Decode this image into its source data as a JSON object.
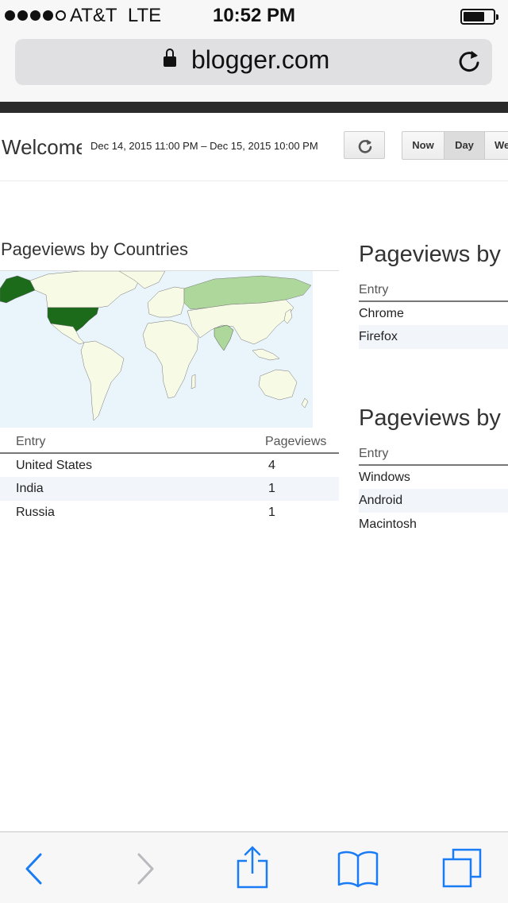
{
  "status_bar": {
    "carrier": "AT&T",
    "network": "LTE",
    "time": "10:52 PM",
    "signal_bars": 4,
    "signal_max": 5
  },
  "address_bar": {
    "url": "blogger.com"
  },
  "toolbar": {
    "welcome": "Welcome",
    "date_range": "Dec 14, 2015 11:00 PM – Dec 15, 2015 10:00 PM",
    "ranges": [
      "Now",
      "Day",
      "Week"
    ],
    "selected_range": "Day"
  },
  "countries": {
    "title": "Pageviews by Countries",
    "columns": [
      "Entry",
      "Pageviews"
    ],
    "rows": [
      {
        "entry": "United States",
        "pageviews": "4"
      },
      {
        "entry": "India",
        "pageviews": "1"
      },
      {
        "entry": "Russia",
        "pageviews": "1"
      }
    ]
  },
  "browsers": {
    "title": "Pageviews by",
    "columns": [
      "Entry"
    ],
    "rows": [
      "Chrome",
      "Firefox"
    ]
  },
  "os": {
    "title": "Pageviews by",
    "columns": [
      "Entry"
    ],
    "rows": [
      "Windows",
      "Android",
      "Macintosh"
    ]
  },
  "colors": {
    "map_high": "#1b6b1b",
    "map_low": "#aed79c",
    "map_none": "#f7fbe6",
    "ocean": "#eaf4fb",
    "ios_blue": "#1a7cf5"
  },
  "icons": [
    "lock-icon",
    "reload-icon",
    "refresh-icon",
    "back-icon",
    "forward-icon",
    "share-icon",
    "bookmarks-icon",
    "tabs-icon"
  ]
}
